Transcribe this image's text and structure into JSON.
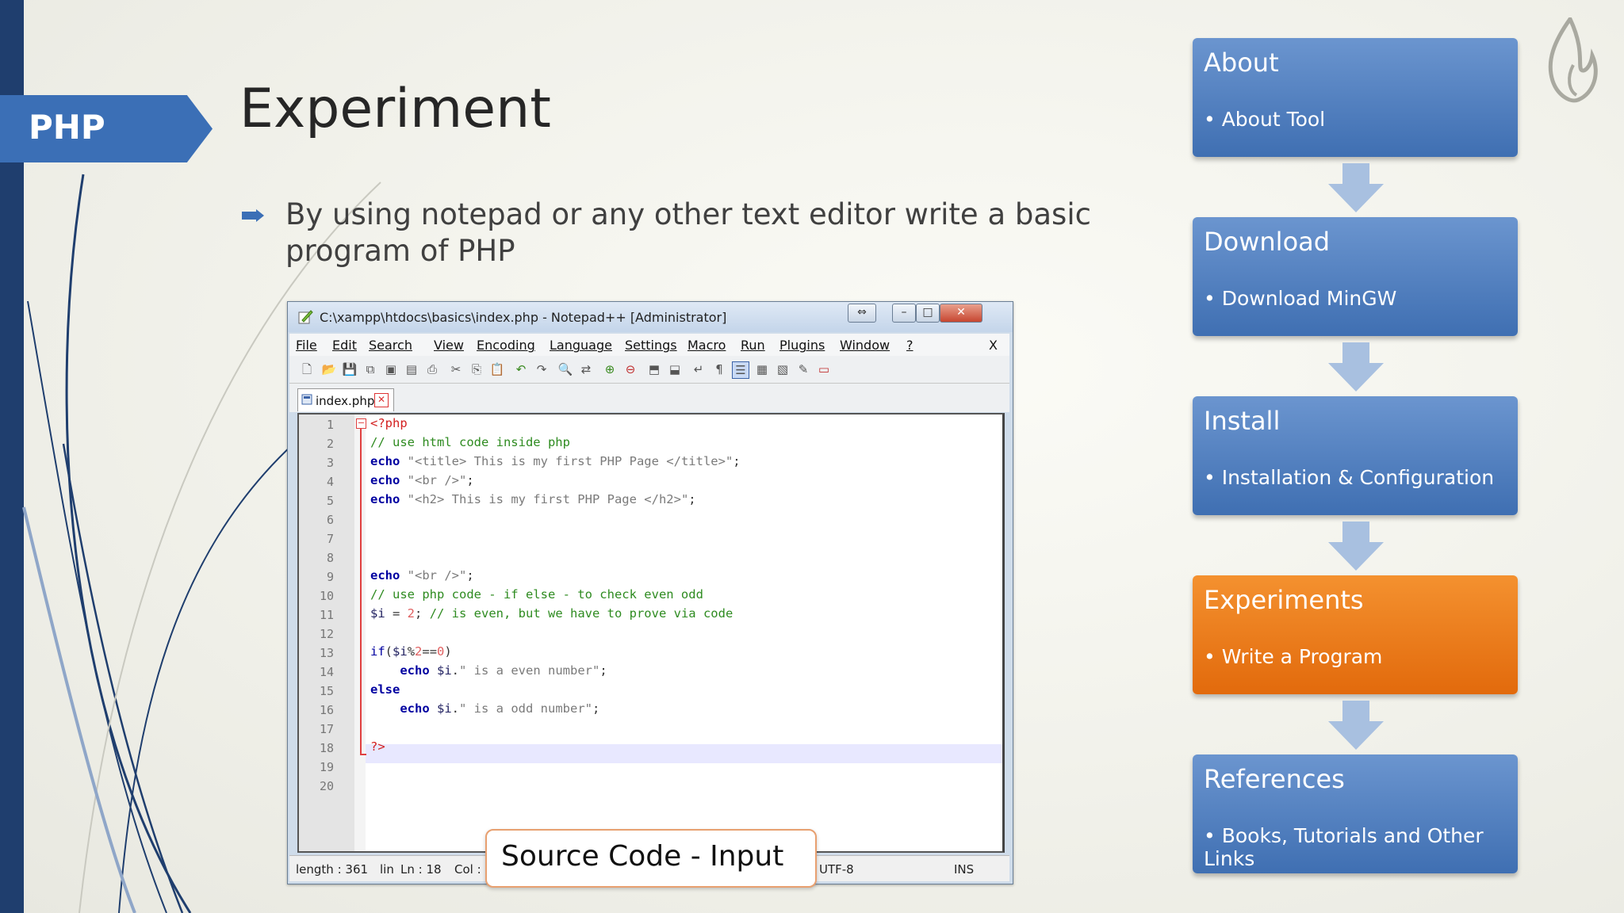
{
  "sidebar_tab": "PHP",
  "slide": {
    "title": "Experiment",
    "bullet": "By using notepad or any other text editor write a basic program of PHP"
  },
  "notepad": {
    "title": "C:\\xampp\\htdocs\\basics\\index.php - Notepad++ [Administrator]",
    "menu": [
      "File",
      "Edit",
      "Search",
      "View",
      "Encoding",
      "Language",
      "Settings",
      "Macro",
      "Run",
      "Plugins",
      "Window",
      "?"
    ],
    "menu_close": "X",
    "tab_name": "index.php",
    "lines": [
      "<?php",
      "// use html code inside php",
      "echo \"<title> This is my first PHP Page </title>\";",
      "echo \"<br />\";",
      "echo \"<h2> This is my first PHP Page </h2>\";",
      "",
      "",
      "",
      "echo \"<br />\";",
      "// use php code - if else - to check even odd",
      "$i = 2; // is even, but we have to prove via code",
      "",
      "if($i%2==0)",
      "    echo $i.\" is a even number\";",
      "else",
      "    echo $i.\" is a odd number\";",
      "",
      "?>",
      "",
      ""
    ],
    "status": {
      "length": "length : 361",
      "lin": "lin",
      "position": "Ln : 18",
      "col": "Col :",
      "encoding": "UTF-8",
      "mode": "INS"
    },
    "callout": "Source Code - Input"
  },
  "flow": [
    {
      "title": "About",
      "sub": "About Tool",
      "active": false
    },
    {
      "title": "Download",
      "sub": "Download MinGW",
      "active": false
    },
    {
      "title": "Install",
      "sub": "Installation & Configuration",
      "active": false
    },
    {
      "title": "Experiments",
      "sub": "Write a Program",
      "active": true
    },
    {
      "title": "References",
      "sub": "Books, Tutorials and Other Links",
      "active": false
    }
  ],
  "colors": {
    "sidebar": "#1f3e6e",
    "tab": "#3b6fb6",
    "flow_box": "#4f7fc0",
    "flow_active": "#ec7a1c",
    "callout_border": "#e8a070"
  }
}
